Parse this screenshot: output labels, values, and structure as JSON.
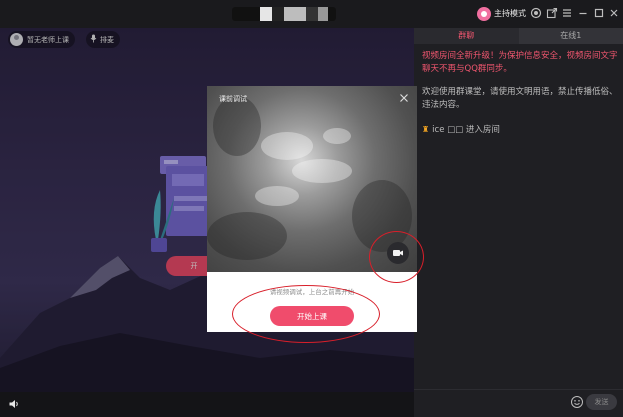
{
  "titlebar": {
    "host_mode": "主持模式",
    "icons": [
      "record-icon",
      "share-icon",
      "menu-icon",
      "minimize-icon",
      "maximize-icon",
      "close-icon"
    ]
  },
  "stage": {
    "teacher_name": "暂无老师上课",
    "queue_label": "排麦",
    "start_button_label": "开"
  },
  "chat": {
    "tabs": [
      {
        "label": "群聊",
        "active": true
      },
      {
        "label": "在线1",
        "active": false
      }
    ],
    "notice": "视频房间全新升级！为保护信息安全，视频房间文字聊天不再与QQ群同步。",
    "welcome": "欢迎使用群课堂，请使用文明用语，禁止传播低俗、违法内容。",
    "join_message": "ice □□ 进入房间",
    "input_placeholder": "",
    "send_label": "发送"
  },
  "dialog": {
    "title": "课前调试",
    "hint": "请视频调试，上台之前再开始",
    "start_button_label": "开始上课"
  },
  "colors": {
    "accent": "#f04c6c",
    "notice_text": "#f0566f",
    "annotation": "#d81f2a"
  }
}
